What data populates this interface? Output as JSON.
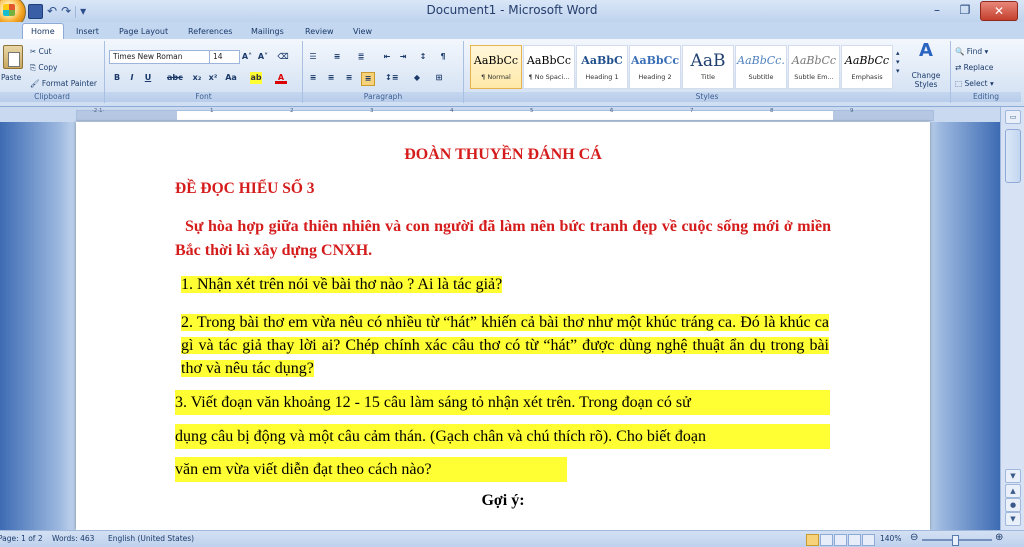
{
  "window": {
    "title": "Document1 - Microsoft Word"
  },
  "tabs": [
    "Home",
    "Insert",
    "Page Layout",
    "References",
    "Mailings",
    "Review",
    "View"
  ],
  "clipboard": {
    "paste": "Paste",
    "cut": "Cut",
    "copy": "Copy",
    "format_painter": "Format Painter",
    "label": "Clipboard"
  },
  "font": {
    "name": "Times New Roman",
    "size": "14",
    "label": "Font"
  },
  "paragraph": {
    "label": "Paragraph"
  },
  "styles": {
    "label": "Styles",
    "items": [
      {
        "sample": "AaBbCc",
        "name": "¶ Normal"
      },
      {
        "sample": "AaBbCc",
        "name": "¶ No Spaci..."
      },
      {
        "sample": "AaBbC",
        "name": "Heading 1"
      },
      {
        "sample": "AaBbCc",
        "name": "Heading 2"
      },
      {
        "sample": "AaB",
        "name": "Title"
      },
      {
        "sample": "AaBbCc.",
        "name": "Subtitle"
      },
      {
        "sample": "AaBbCc",
        "name": "Subtle Em..."
      },
      {
        "sample": "AaBbCc",
        "name": "Emphasis"
      }
    ],
    "change_styles": "Change Styles"
  },
  "editing": {
    "label": "Editing",
    "find": "Find",
    "replace": "Replace",
    "select": "Select"
  },
  "document": {
    "title": "ĐOÀN THUYỀN ĐÁNH CÁ",
    "subtitle": "ĐỀ ĐỌC HIỂU SỐ 3",
    "intro": "Sự hòa hợp giữa thiên nhiên và con người đã làm nên bức tranh đẹp về cuộc sống mới ở miền Bắc thời kì xây dựng CNXH.",
    "q1": "1. Nhận xét trên nói về bài thơ nào ? Ai là tác giả?",
    "q2": "2. Trong bài thơ em vừa nêu có nhiều từ “hát” khiến cả bài thơ như một khúc tráng ca. Đó là khúc ca gì và tác giả thay lời ai? Chép chính xác câu thơ có từ “hát” được dùng nghệ thuật ẩn dụ trong bài thơ và nêu tác dụng?",
    "q3_lines": [
      "3. Viết đoạn văn khoảng 12 - 15 câu làm sáng tỏ nhận xét trên. Trong đoạn có sử",
      "dụng câu bị động và một câu cảm thán. (Gạch chân và chú thích rõ). Cho biết đoạn",
      "văn em vừa viết diễn đạt theo cách nào?"
    ],
    "hint": "Gợi ý:"
  },
  "status": {
    "page": "Page: 1 of 2",
    "words": "Words: 463",
    "language": "English (United States)",
    "zoom": "140%"
  }
}
